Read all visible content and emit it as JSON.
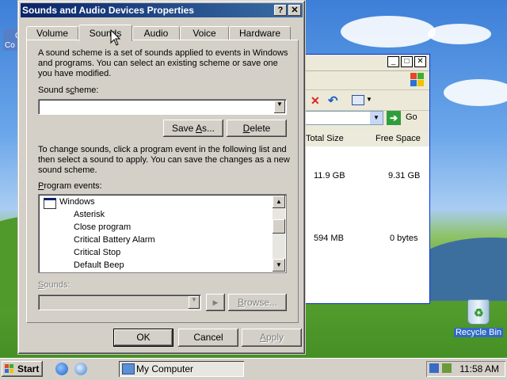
{
  "colors": {
    "title_bar": "#0a246a",
    "dialog_bg": "#d4d0c8",
    "selection": "#316ac5"
  },
  "dialog": {
    "title": "Sounds and Audio Devices Properties",
    "help_btn": "?",
    "close_btn": "✕",
    "tabs": [
      "Volume",
      "Sounds",
      "Audio",
      "Voice",
      "Hardware"
    ],
    "active_tab": "Sounds",
    "scheme_description": "A sound scheme is a set of sounds applied to events in Windows and programs. You can select an existing scheme or save one you have modified.",
    "scheme_label_a": "Sound s",
    "scheme_label_u": "c",
    "scheme_label_b": "heme:",
    "scheme_value": "",
    "save_as_a": "Save ",
    "save_as_u": "A",
    "save_as_b": "s...",
    "delete_a": "",
    "delete_u": "D",
    "delete_b": "elete",
    "events_description": "To change sounds, click a program event in the following list and then select a sound to apply. You can save the changes as a new sound scheme.",
    "events_label_a": "",
    "events_label_u": "P",
    "events_label_b": "rogram events:",
    "events": [
      "Windows",
      "Asterisk",
      "Close program",
      "Critical Battery Alarm",
      "Critical Stop",
      "Default Beep"
    ],
    "sounds_label_a": "",
    "sounds_label_u": "S",
    "sounds_label_b": "ounds:",
    "sound_value": "",
    "play_icon": "play-icon",
    "browse_a": "",
    "browse_u": "B",
    "browse_b": "rowse...",
    "ok": "OK",
    "cancel": "Cancel",
    "apply_a": "",
    "apply_u": "A",
    "apply_b": "pply"
  },
  "explorer": {
    "address_go": "Go",
    "columns": [
      "Total Size",
      "Free Space"
    ],
    "rows": [
      {
        "total": "11.9 GB",
        "free": "9.31 GB"
      },
      {
        "total": "594 MB",
        "free": "0 bytes"
      }
    ]
  },
  "desktop": {
    "recycle_bin": "Recycle Bin",
    "partial_icon_label_a": "C",
    "partial_icon_label_b": "Co"
  },
  "taskbar": {
    "start": "Start",
    "task_label": "My Computer",
    "clock": "11:58 AM"
  }
}
